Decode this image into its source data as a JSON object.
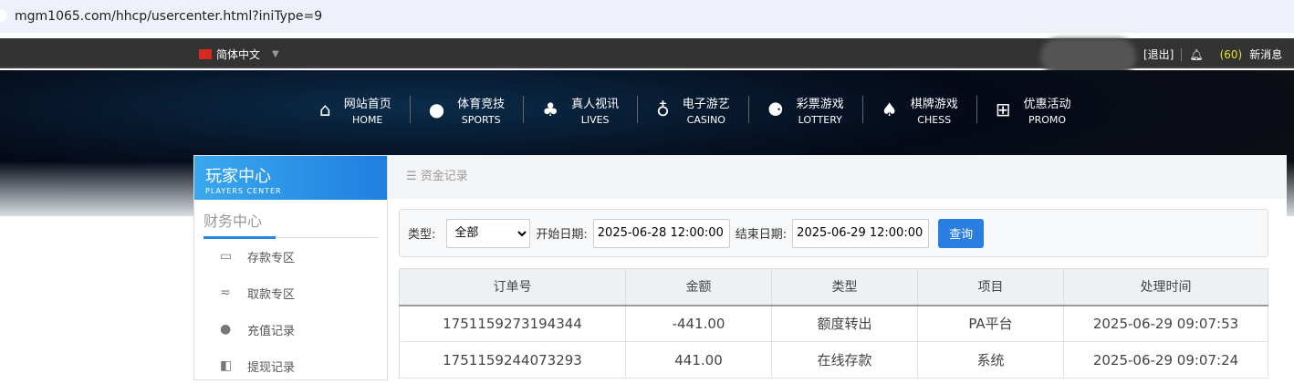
{
  "browser": {
    "url": "mgm1065.com/hhcp/usercenter.html?iniType=9"
  },
  "topbar": {
    "language": "简体中文",
    "logout": "[退出]",
    "message_count": "(60)",
    "messages_label": "新消息"
  },
  "nav": [
    {
      "cn": "网站首页",
      "en": "HOME",
      "icon": "home-icon",
      "glyph": "⌂"
    },
    {
      "cn": "体育竞技",
      "en": "SPORTS",
      "icon": "ball-icon",
      "glyph": "●"
    },
    {
      "cn": "真人视讯",
      "en": "LIVES",
      "icon": "cards-icon",
      "glyph": "♣"
    },
    {
      "cn": "电子游艺",
      "en": "CASINO",
      "icon": "joystick-icon",
      "glyph": "♁"
    },
    {
      "cn": "彩票游戏",
      "en": "LOTTERY",
      "icon": "lottery-balls-icon",
      "glyph": "⚈"
    },
    {
      "cn": "棋牌游戏",
      "en": "CHESS",
      "icon": "spade-icon",
      "glyph": "♠"
    },
    {
      "cn": "优惠活动",
      "en": "PROMO",
      "icon": "gift-icon",
      "glyph": "⊞"
    }
  ],
  "sidebar": {
    "title": "玩家中心",
    "subtitle": "PLAYERS CENTER",
    "section": "财务中心",
    "items": [
      {
        "label": "存款专区",
        "glyph": "▭"
      },
      {
        "label": "取款专区",
        "glyph": "≂"
      },
      {
        "label": "充值记录",
        "glyph": "●"
      },
      {
        "label": "提现记录",
        "glyph": "◧"
      }
    ]
  },
  "main": {
    "breadcrumb": "资金记录",
    "menu_glyph": "☰",
    "filter": {
      "type_label": "类型:",
      "type_value": "全部",
      "start_label": "开始日期:",
      "start_value": "2025-06-28 12:00:00",
      "end_label": "结束日期:",
      "end_value": "2025-06-29 12:00:00",
      "query": "查询"
    },
    "table": {
      "headers": [
        "订单号",
        "金额",
        "类型",
        "项目",
        "处理时间"
      ],
      "rows": [
        [
          "1751159273194344",
          "-441.00",
          "额度转出",
          "PA平台",
          "2025-06-29 09:07:53"
        ],
        [
          "1751159244073293",
          "441.00",
          "在线存款",
          "系统",
          "2025-06-29 09:07:24"
        ]
      ]
    }
  },
  "colors": {
    "accent": "#2a7de1",
    "count": "#e4e23a"
  }
}
